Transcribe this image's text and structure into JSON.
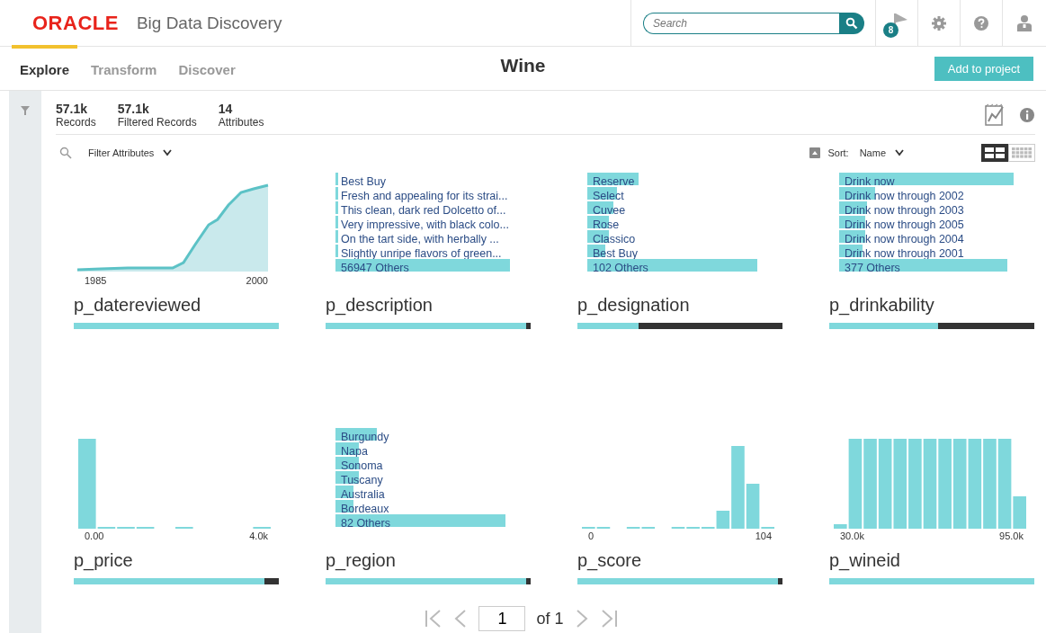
{
  "header": {
    "logo": "ORACLE",
    "product": "Big Data Discovery",
    "search": {
      "placeholder": "Search"
    },
    "notification_count": "8"
  },
  "tabs": [
    {
      "label": "Explore",
      "selected": true
    },
    {
      "label": "Transform",
      "selected": false
    },
    {
      "label": "Discover",
      "selected": false
    }
  ],
  "page_title": "Wine",
  "add_button": "Add to project",
  "stats": [
    {
      "value": "57.1k",
      "label": "Records"
    },
    {
      "value": "57.1k",
      "label": "Filtered Records"
    },
    {
      "value": "14",
      "label": "Attributes"
    }
  ],
  "toolbar": {
    "filter": "Filter Attributes",
    "sort_label": "Sort:",
    "sort_value": "Name",
    "view_toggle": [
      {
        "kind": "grid",
        "selected": true
      },
      {
        "kind": "list",
        "selected": false
      }
    ]
  },
  "cards": [
    {
      "name": "p_datereviewed",
      "kind": "area",
      "axis_min": "1985",
      "axis_max": "2000",
      "level": 1.0
    },
    {
      "name": "p_description",
      "kind": "list",
      "level": 0.98,
      "items": [
        {
          "label": "Best Buy",
          "level": 0.014
        },
        {
          "label": "Fresh and appealing for its strai...",
          "level": 0.014
        },
        {
          "label": "This clean, dark red Dolcetto of...",
          "level": 0.014
        },
        {
          "label": "Very impressive, with black colo...",
          "level": 0.014
        },
        {
          "label": "On the tart side, with herbally ...",
          "level": 0.014
        },
        {
          "label": "Slightly unripe flavors of green...",
          "level": 0.014
        },
        {
          "label": "56947 Others",
          "level": 0.88
        }
      ]
    },
    {
      "name": "p_designation",
      "kind": "list",
      "level": 0.3,
      "items": [
        {
          "label": "Reserve",
          "level": 0.26
        },
        {
          "label": "Select",
          "level": 0.15
        },
        {
          "label": "Cuvee",
          "level": 0.13
        },
        {
          "label": "Rose",
          "level": 0.11
        },
        {
          "label": "Classico",
          "level": 0.11
        },
        {
          "label": "Best Buy",
          "level": 0.09
        },
        {
          "label": "102 Others",
          "level": 0.86
        }
      ]
    },
    {
      "name": "p_drinkability",
      "kind": "list",
      "level": 0.53,
      "items": [
        {
          "label": "Drink now",
          "level": 0.88
        },
        {
          "label": "Drink now through 2002",
          "level": 0.18
        },
        {
          "label": "Drink now through 2003",
          "level": 0.14
        },
        {
          "label": "Drink now through 2005",
          "level": 0.13
        },
        {
          "label": "Drink now through 2004",
          "level": 0.13
        },
        {
          "label": "Drink now through 2001",
          "level": 0.12
        },
        {
          "label": "377 Others",
          "level": 0.85
        }
      ]
    },
    {
      "name": "p_price",
      "kind": "histogram",
      "axis_min": "0.00",
      "axis_max": "4.0k",
      "level": 0.93
    },
    {
      "name": "p_region",
      "kind": "list",
      "level": 0.98,
      "items": [
        {
          "label": "Burgundy",
          "level": 0.21
        },
        {
          "label": "Napa",
          "level": 0.12
        },
        {
          "label": "Sonoma",
          "level": 0.12
        },
        {
          "label": "Tuscany",
          "level": 0.12
        },
        {
          "label": "Australia",
          "level": 0.09
        },
        {
          "label": "Bordeaux",
          "level": 0.09
        },
        {
          "label": "82 Others",
          "level": 0.86
        }
      ]
    },
    {
      "name": "p_score",
      "kind": "histogram",
      "axis_min": "0",
      "axis_max": "104",
      "level": 0.98
    },
    {
      "name": "p_wineid",
      "kind": "histogram",
      "axis_min": "30.0k",
      "axis_max": "95.0k",
      "level": 1.0
    }
  ],
  "pagination": {
    "page": "1",
    "of": "of 1"
  }
}
